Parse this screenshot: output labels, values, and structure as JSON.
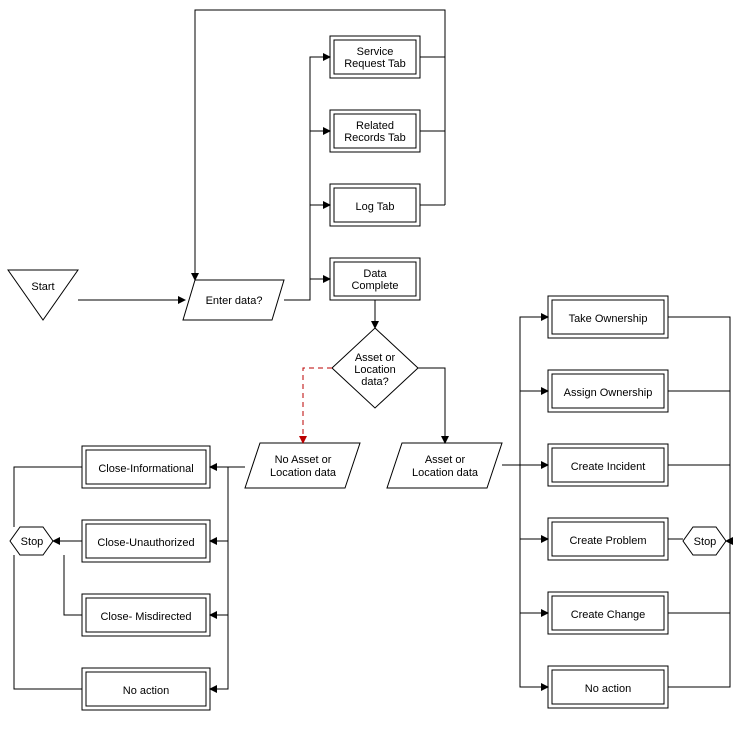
{
  "nodes": {
    "start": "Start",
    "enter_data": "Enter data?",
    "service_request_tab": "Service\nRequest Tab",
    "related_records_tab": "Related\nRecords Tab",
    "log_tab": "Log Tab",
    "data_complete": "Data\nComplete",
    "asset_decision": "Asset or\nLocation\ndata?",
    "no_asset": "No Asset or\nLocation data",
    "asset_data": "Asset or\nLocation data",
    "close_informational": "Close-Informational",
    "close_unauthorized": "Close-Unauthorized",
    "close_misdirected": "Close- Misdirected",
    "no_action_left": "No action",
    "take_ownership": "Take Ownership",
    "assign_ownership": "Assign Ownership",
    "create_incident": "Create Incident",
    "create_problem": "Create Problem",
    "create_change": "Create Change",
    "no_action_right": "No action",
    "stop_left": "Stop",
    "stop_right": "Stop"
  }
}
